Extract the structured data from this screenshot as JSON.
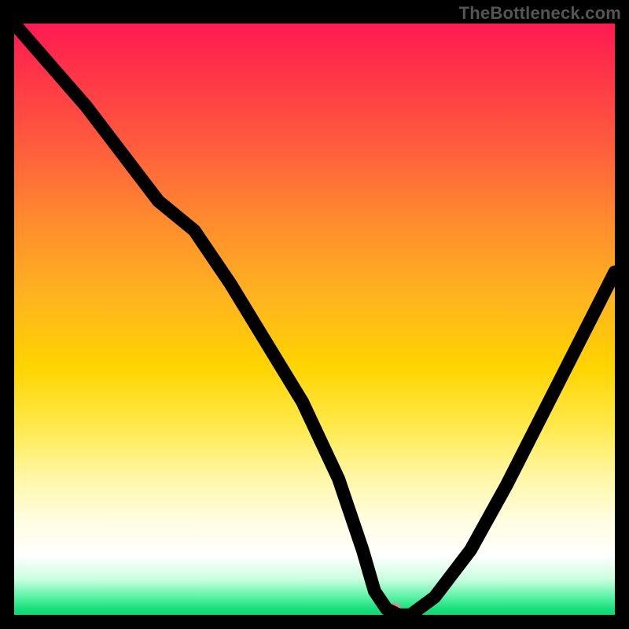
{
  "attribution": "TheBottleneck.com",
  "marker": {
    "x_pct": 63,
    "y_pct": 99
  },
  "chart_data": {
    "type": "line",
    "title": "",
    "xlabel": "",
    "ylabel": "",
    "xlim": [
      0,
      100
    ],
    "ylim": [
      0,
      100
    ],
    "series": [
      {
        "name": "bottleneck-curve",
        "x": [
          0,
          6,
          12,
          18,
          24,
          30,
          36,
          42,
          48,
          54,
          58,
          60,
          62,
          64,
          66,
          70,
          76,
          82,
          88,
          94,
          100
        ],
        "y": [
          100,
          93,
          86,
          78,
          70,
          65,
          56,
          46,
          36,
          23,
          11,
          4,
          1,
          0,
          0,
          3,
          11,
          22,
          34,
          46,
          58
        ]
      }
    ],
    "annotations": [
      {
        "name": "optimal-marker",
        "x": 63,
        "y": 0.5
      }
    ],
    "background_gradient": {
      "orientation": "vertical",
      "stops": [
        {
          "pct": 0,
          "color": "#ff1a52"
        },
        {
          "pct": 33,
          "color": "#ff8a2e"
        },
        {
          "pct": 58,
          "color": "#ffd400"
        },
        {
          "pct": 84,
          "color": "#fffde0"
        },
        {
          "pct": 100,
          "color": "#0fd873"
        }
      ]
    }
  }
}
